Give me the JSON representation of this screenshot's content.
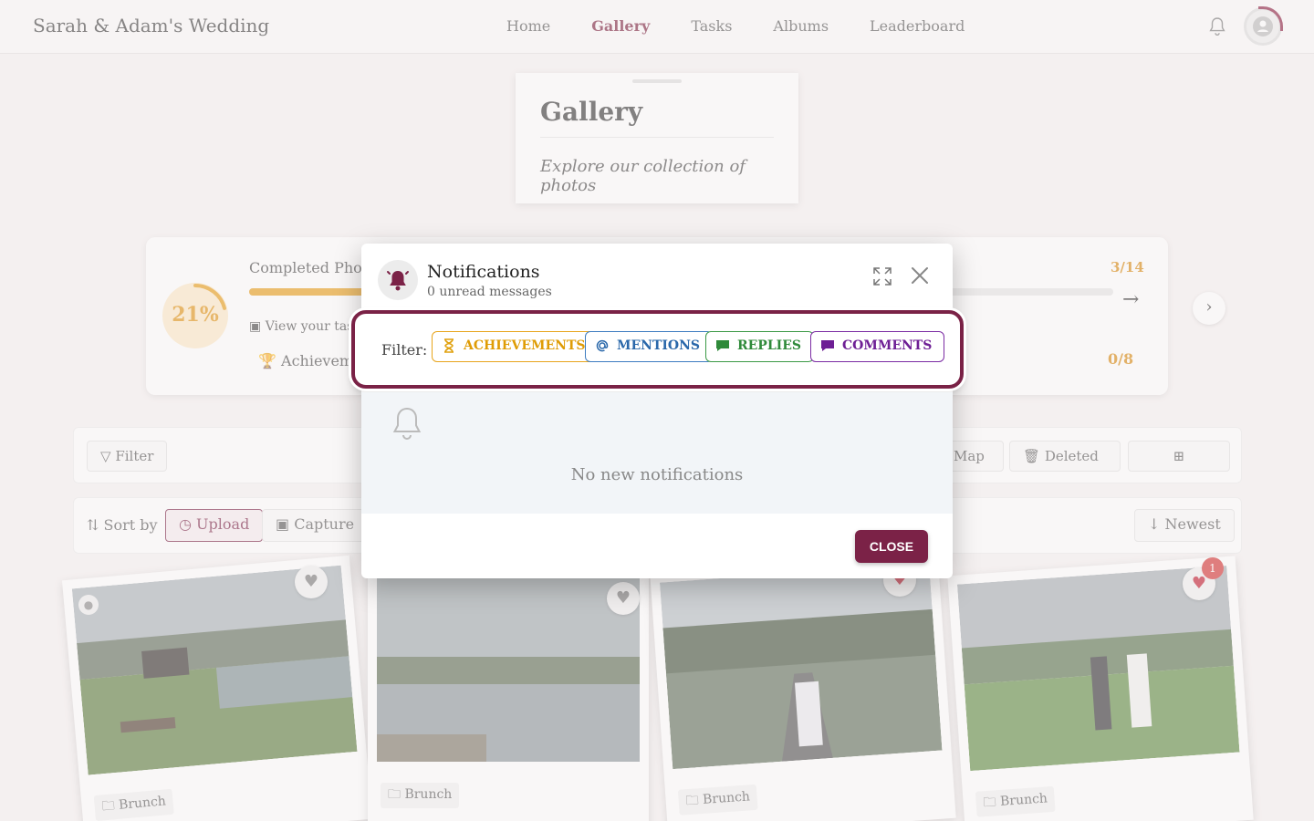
{
  "header": {
    "brand": "Sarah & Adam's Wedding",
    "nav": [
      {
        "label": "Home",
        "active": false
      },
      {
        "label": "Gallery",
        "active": true
      },
      {
        "label": "Tasks",
        "active": false
      },
      {
        "label": "Albums",
        "active": false
      },
      {
        "label": "Leaderboard",
        "active": false
      }
    ]
  },
  "gallery_card": {
    "title": "Gallery",
    "subtitle": "Explore our collection of photos"
  },
  "progress": {
    "percent_label": "21%",
    "percent_value": 0.21,
    "title": "Completed Photo",
    "view_label": "View your task p",
    "achievements_label": "Achieveme",
    "count": "3/14",
    "count_fraction": 0.21,
    "achievement_count": "0/8"
  },
  "toolbar": {
    "filter_label": "Filter",
    "map_label": "Map",
    "deleted_label": "Deleted",
    "sort_label": "Sort by",
    "upload_label": "Upload",
    "capture_label": "Capture",
    "newest_label": "Newest"
  },
  "photos": [
    {
      "tag": "Brunch"
    },
    {
      "tag": "Brunch"
    },
    {
      "tag": "Brunch"
    },
    {
      "tag": "Brunch",
      "badge": "1"
    }
  ],
  "modal": {
    "title": "Notifications",
    "subtitle": "0 unread messages",
    "filter_label": "Filter:",
    "chips": {
      "achievements": "ACHIEVEMENTS",
      "mentions": "MENTIONS",
      "replies": "REPLIES",
      "comments": "COMMENTS"
    },
    "empty_text": "No new notifications",
    "close_label": "CLOSE"
  },
  "colors": {
    "brand": "#7a2246",
    "achievements": "#e8a51c",
    "mentions": "#3d7cc0",
    "replies": "#3b9945",
    "comments": "#7b2ba3"
  }
}
